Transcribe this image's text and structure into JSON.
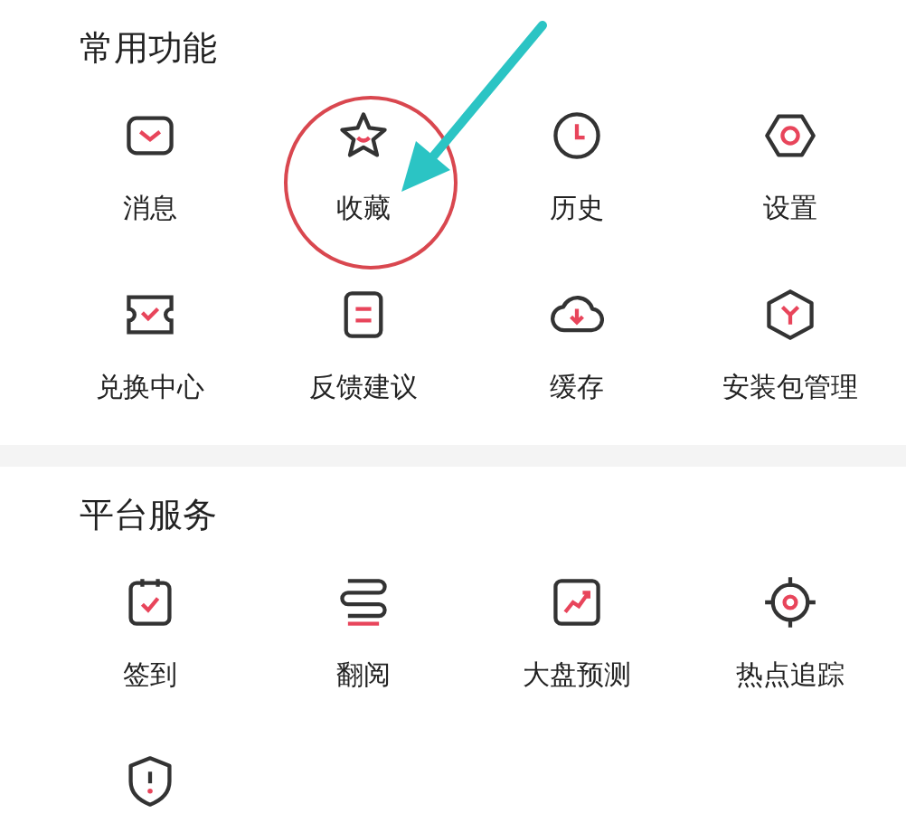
{
  "sections": [
    {
      "title": "常用功能",
      "items": [
        {
          "kind": "labeled",
          "label": "消息"
        },
        {
          "kind": "labeled",
          "label": "收藏"
        },
        {
          "kind": "labeled",
          "label": "历史"
        },
        {
          "kind": "labeled",
          "label": "设置"
        },
        {
          "kind": "labeled",
          "label": "兑换中心"
        },
        {
          "kind": "labeled",
          "label": "反馈建议"
        },
        {
          "kind": "labeled",
          "label": "缓存"
        },
        {
          "kind": "labeled",
          "label": "安装包管理"
        }
      ]
    },
    {
      "title": "平台服务",
      "items": [
        {
          "kind": "labeled",
          "label": "签到"
        },
        {
          "kind": "labeled",
          "label": "翻阅"
        },
        {
          "kind": "labeled",
          "label": "大盘预测"
        },
        {
          "kind": "labeled",
          "label": "热点追踪"
        },
        {
          "kind": "iconOnly"
        }
      ]
    }
  ]
}
